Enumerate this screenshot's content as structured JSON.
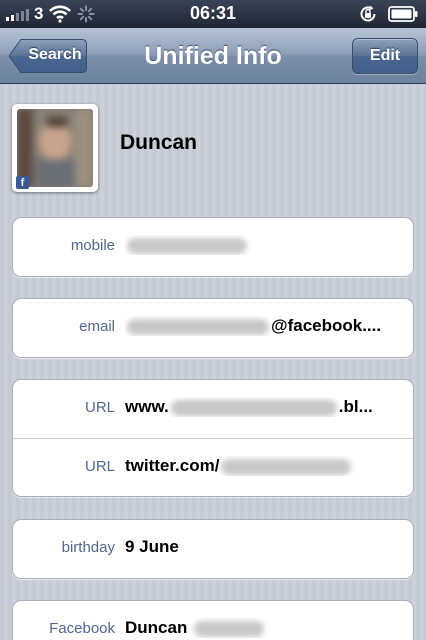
{
  "status_bar": {
    "carrier": "3",
    "time": "06:31"
  },
  "nav": {
    "back_label": "Search",
    "title": "Unified Info",
    "edit_label": "Edit"
  },
  "contact": {
    "name": "Duncan",
    "badge": "f"
  },
  "fields": {
    "mobile": {
      "label": "mobile"
    },
    "email": {
      "label": "email",
      "value_suffix": "@facebook...."
    },
    "url1": {
      "label": "URL",
      "value_prefix": "www.",
      "value_suffix": ".bl..."
    },
    "url2": {
      "label": "URL",
      "value_prefix": "twitter.com/"
    },
    "birthday": {
      "label": "birthday",
      "value": "9 June"
    },
    "facebook": {
      "label": "Facebook",
      "value_prefix": "Duncan"
    }
  },
  "colors": {
    "label_blue": "#516691",
    "nav_gradient_top": "#b8c4d4",
    "nav_gradient_bottom": "#6d82a0",
    "facebook_blue": "#3b5998"
  },
  "icons": [
    "signal-bars-icon",
    "wifi-icon",
    "activity-spinner-icon",
    "rotation-lock-icon",
    "battery-icon",
    "facebook-badge-icon"
  ]
}
